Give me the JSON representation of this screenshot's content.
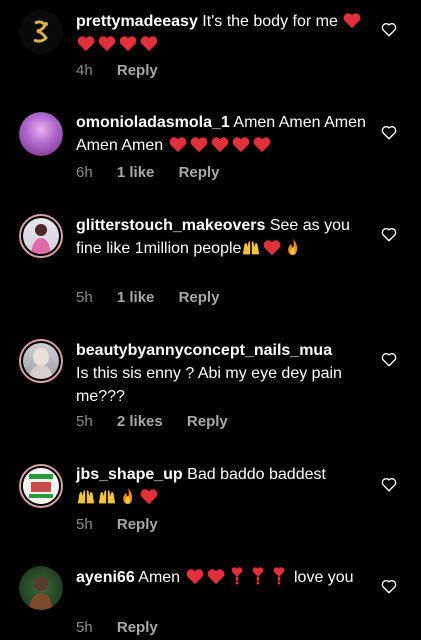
{
  "comments": [
    {
      "username": "prettymadeeasy",
      "text": "It's the body for me",
      "emoji": [
        "heart",
        "heart",
        "heart",
        "heart",
        "heart"
      ],
      "time": "4h",
      "likes": "",
      "reply": "Reply"
    },
    {
      "username": "omonioladasmola_1",
      "text": "Amen Amen Amen Amen Amen",
      "emoji": [
        "heart",
        "heart",
        "heart",
        "heart",
        "heart"
      ],
      "time": "6h",
      "likes": "1 like",
      "reply": "Reply"
    },
    {
      "username": "glitterstouch_makeovers",
      "text": "See as you fine like 1million people",
      "emoji": [
        "raised-hands",
        "heart",
        "fire"
      ],
      "time": "5h",
      "likes": "1 like",
      "reply": "Reply"
    },
    {
      "username": "beautybyannyconcept_nails_mua",
      "text": "Is this sis enny ? Abi my eye dey pain me???",
      "emoji": [],
      "time": "5h",
      "likes": "2 likes",
      "reply": "Reply"
    },
    {
      "username": "jbs_shape_up",
      "text": "Bad baddo baddest",
      "emoji": [
        "raised-hands",
        "raised-hands",
        "fire",
        "heart"
      ],
      "time": "5h",
      "likes": "",
      "reply": "Reply"
    },
    {
      "username": "ayeni66",
      "text": "Amen",
      "text_after": "love you",
      "emoji": [
        "heart",
        "heart",
        "heart-exclamation",
        "heart-exclamation",
        "heart-exclamation"
      ],
      "time": "5h",
      "likes": "",
      "reply": "Reply"
    }
  ],
  "colors": {
    "background": "#000000",
    "meta": "#8e8e8e",
    "heart": "#e0303a"
  }
}
